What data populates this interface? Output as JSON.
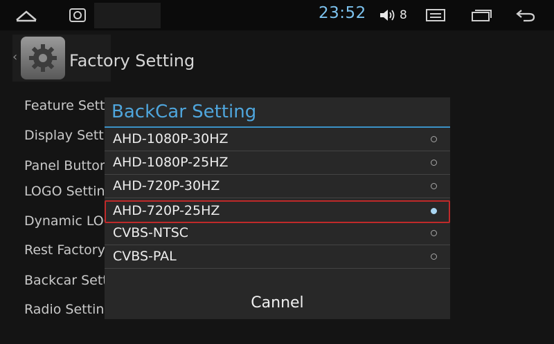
{
  "status_bar": {
    "time": "23:52",
    "volume_level": "8",
    "icons": [
      "home-icon",
      "gallery-icon",
      "volume-icon",
      "menu-icon",
      "recent-apps-icon",
      "back-icon"
    ]
  },
  "page": {
    "title": "Factory Setting",
    "menu_items": [
      {
        "label": "Feature Setting"
      },
      {
        "label": "Display Setting"
      },
      {
        "label": "Panel Button"
      },
      {
        "label": "LOGO Setting"
      },
      {
        "label": "Dynamic LOGO"
      },
      {
        "label": "Rest Factory"
      },
      {
        "label": "Backcar Setting"
      },
      {
        "label": "Radio Setting"
      }
    ]
  },
  "dialog": {
    "title": "BackCar Setting",
    "options": [
      {
        "label": "AHD-1080P-30HZ",
        "selected": false
      },
      {
        "label": "AHD-1080P-25HZ",
        "selected": false
      },
      {
        "label": "AHD-720P-30HZ",
        "selected": false
      },
      {
        "label": "AHD-720P-25HZ",
        "selected": true
      },
      {
        "label": "CVBS-NTSC",
        "selected": false
      },
      {
        "label": "CVBS-PAL",
        "selected": false
      }
    ],
    "cancel_label": "Cannel"
  },
  "colors": {
    "accent": "#4fa6dd",
    "selection_border": "#c02a2a",
    "clock": "#7cc2ee"
  }
}
